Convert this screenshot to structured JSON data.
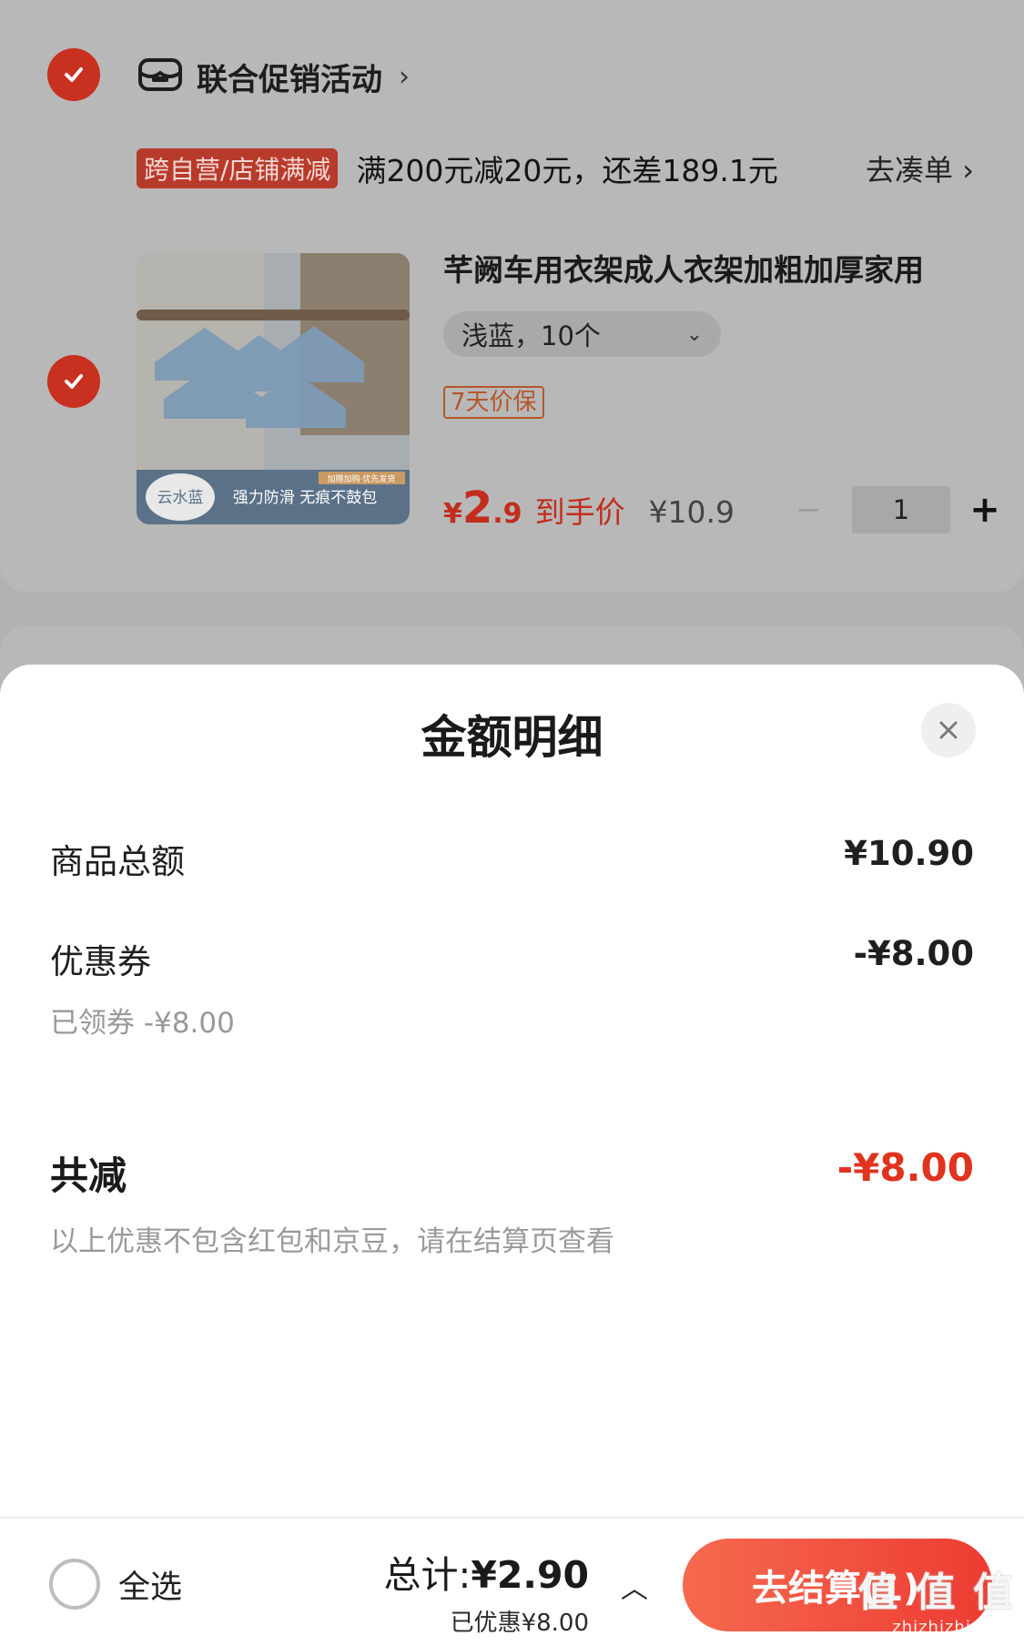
{
  "cart": {
    "promo_title": "联合促销活动",
    "promo_tag": "跨自营/店铺满减",
    "promo_text": "满200元减20元，还差189.1元",
    "promo_link": "去凑单 ›",
    "product": {
      "title": "芊阙车用衣架成人衣架加粗加厚家用",
      "sku": "浅蓝，10个",
      "badge": "7天价保",
      "price_currency": "¥",
      "price_int": "2",
      "price_dec": ".9",
      "price_label": "到手价",
      "original_price": "¥10.9",
      "qty_minus": "−",
      "quantity": "1",
      "qty_plus": "+",
      "image_caption_left": "云水蓝",
      "image_caption_main": "强力防滑 无痕不鼓包",
      "image_caption_top": "加赠加购·优先发货"
    }
  },
  "sheet": {
    "title": "金额明细",
    "rows": [
      {
        "label": "商品总额",
        "value": "¥10.90"
      },
      {
        "label": "优惠券",
        "value": "-¥8.00",
        "sub": "已领券 -¥8.00"
      }
    ],
    "total_label": "共减",
    "total_value": "-¥8.00",
    "note": "以上优惠不包含红包和京豆，请在结算页查看"
  },
  "bottom": {
    "select_all": "全选",
    "total_prefix": "总计:",
    "total_value": "¥2.90",
    "saved": "已优惠¥8.00",
    "checkout": "去结算(1)",
    "watermark": "值 值 值",
    "watermark_url": "zhizhizhi.com"
  },
  "colors": {
    "accent": "#e0331e",
    "check": "#c8301f"
  },
  "icons": {
    "check": "check-icon",
    "shop": "shop-icon",
    "close": "close-icon"
  }
}
